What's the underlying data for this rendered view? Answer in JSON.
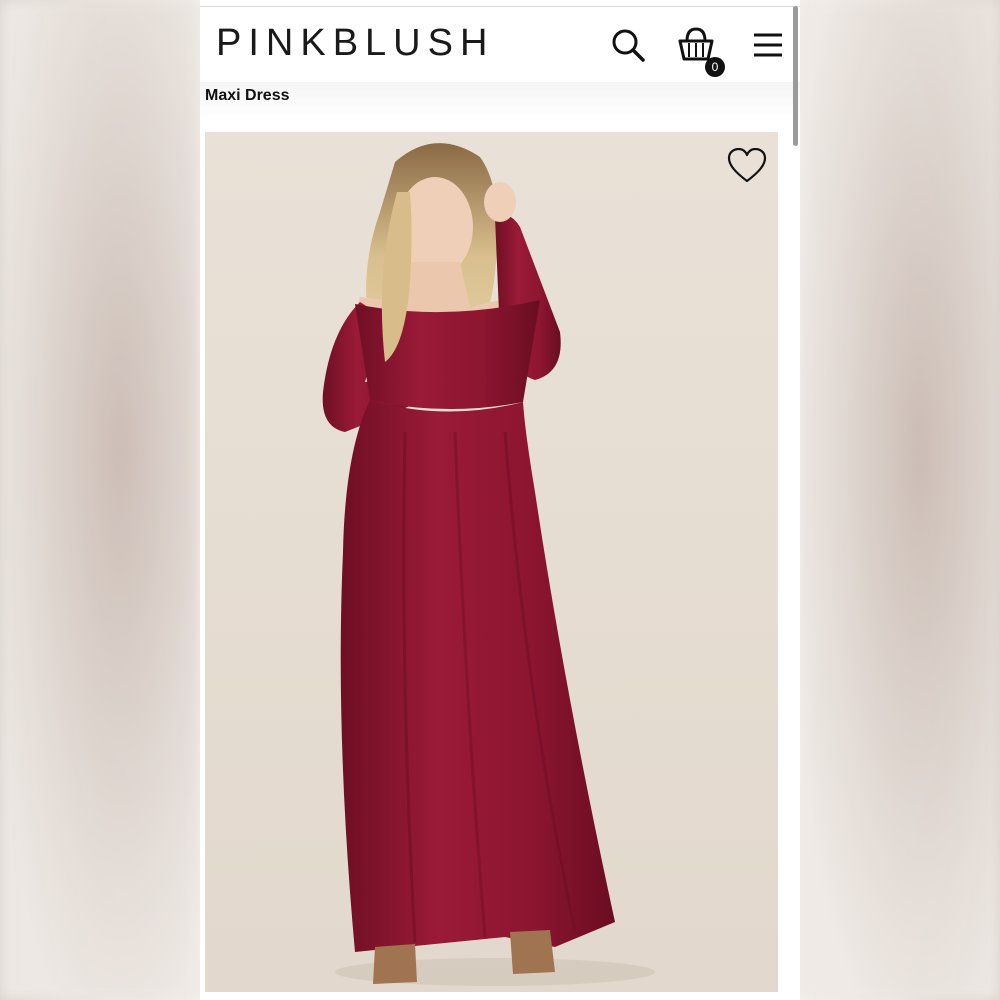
{
  "app": {
    "brand": "PINKBLUSH"
  },
  "header": {
    "cart_count": "0",
    "icons": [
      "search-icon",
      "shopping-bag-icon",
      "hamburger-menu-icon"
    ]
  },
  "product": {
    "title": "Maxi Dress",
    "image_alt": "Model wearing burgundy off-the-shoulder long sleeve maxi dress",
    "favorite_icon": "heart-icon",
    "colors": {
      "dress": "#8e1530",
      "background": "#e6ddd2"
    }
  }
}
